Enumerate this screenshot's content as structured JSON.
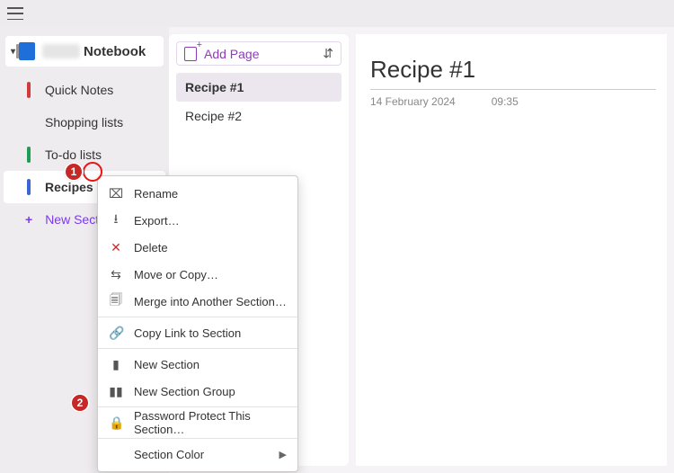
{
  "notebook": {
    "title_suffix": "Notebook"
  },
  "sections": [
    {
      "label": "Quick Notes",
      "color": "#d13b3b"
    },
    {
      "label": "Shopping lists",
      "color": "transparent"
    },
    {
      "label": "To-do lists",
      "color": "#1e9e54"
    },
    {
      "label": "Recipes",
      "color": "#3a66d1",
      "selected": true
    }
  ],
  "new_section_label": "New Section",
  "pages_panel": {
    "add_label": "Add Page",
    "items": [
      {
        "title": "Recipe #1",
        "selected": true
      },
      {
        "title": "Recipe #2"
      }
    ]
  },
  "page": {
    "title": "Recipe #1",
    "date": "14 February 2024",
    "time": "09:35"
  },
  "context_menu": {
    "rename": "Rename",
    "export": "Export…",
    "delete": "Delete",
    "move_copy": "Move or Copy…",
    "merge": "Merge into Another Section…",
    "copy_link": "Copy Link to Section",
    "new_section": "New Section",
    "new_group": "New Section Group",
    "password": "Password Protect This Section…",
    "color": "Section Color"
  },
  "annotations": {
    "badge1": "1",
    "badge2": "2"
  }
}
